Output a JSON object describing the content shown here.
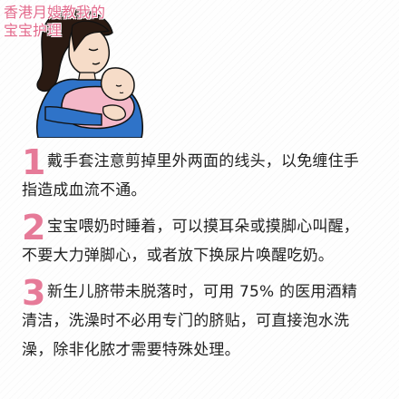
{
  "heading": {
    "line1": "香港月嫂教我的",
    "line2": "宝宝护理"
  },
  "illustration": {
    "icon": "mother-holding-baby-illustration",
    "colors": {
      "mother_shirt": "#2f73c8",
      "baby_blanket": "#f4b8c8",
      "skin": "#f6dcc8",
      "hair": "#2a1a12",
      "outline": "#111111"
    }
  },
  "tips": [
    {
      "number": "1",
      "lines": [
        "戴手套注意剪掉里外两面的线头，以免缠住手",
        "指造成血流不通。"
      ]
    },
    {
      "number": "2",
      "lines": [
        "宝宝喂奶时睡着，可以摸耳朵或摸脚心叫醒，",
        "不要大力弹脚心，或者放下换尿片唤醒吃奶。"
      ]
    },
    {
      "number": "3",
      "lines": [
        "新生儿脐带未脱落时，可用 75% 的医用酒精",
        "清洁，洗澡时不必用专门的脐贴，可直接泡水洗",
        "澡，除非化脓才需要特殊处理。"
      ]
    }
  ],
  "colors": {
    "accent_pink": "#e67a98",
    "title_pink": "#e36b8d",
    "text": "#222222"
  }
}
